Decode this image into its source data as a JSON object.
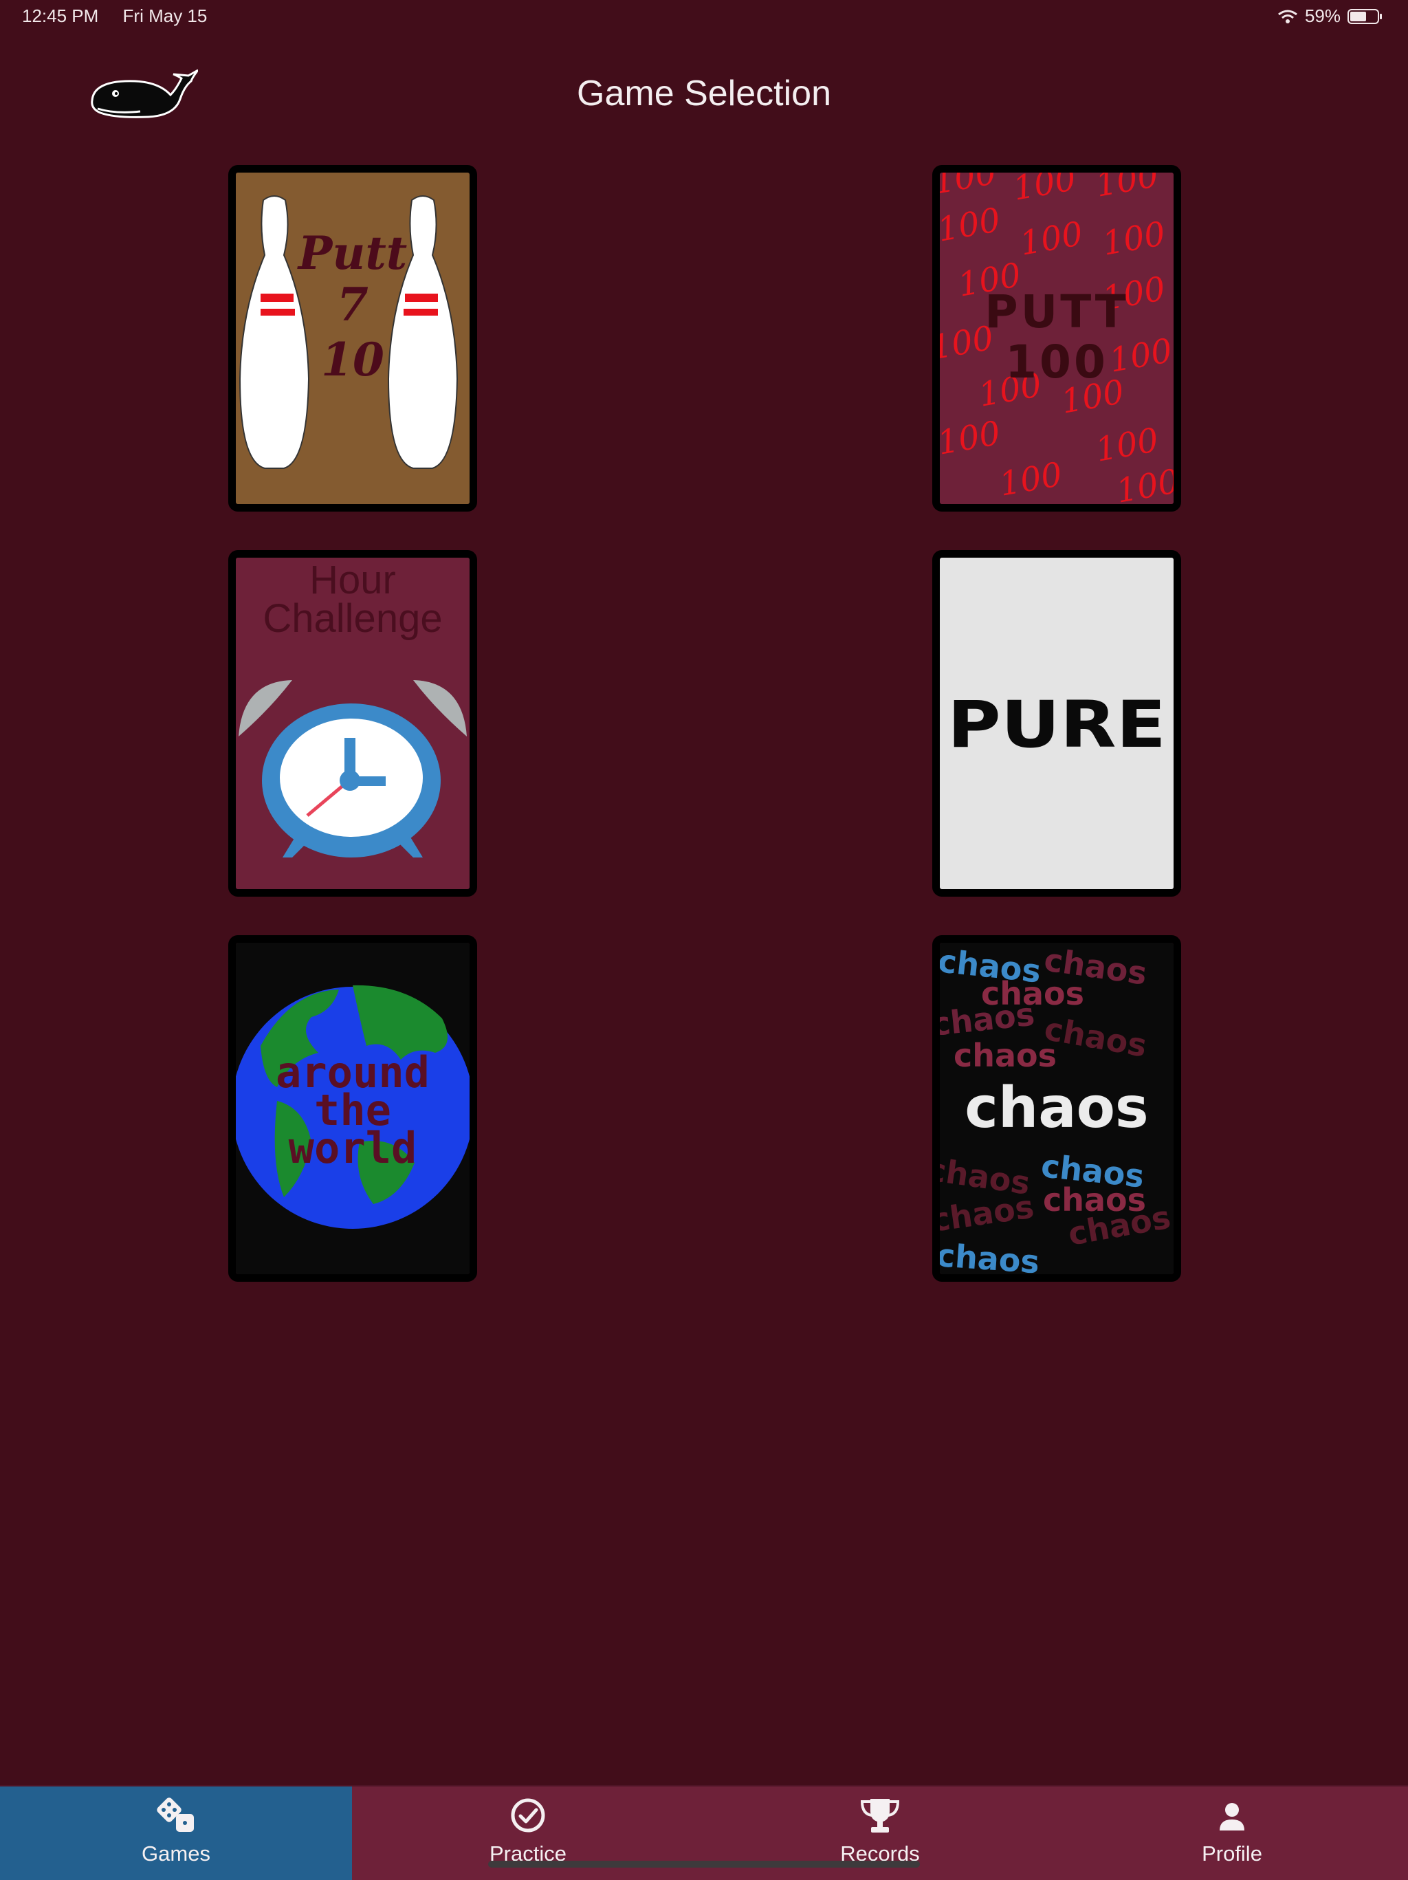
{
  "status": {
    "time": "12:45 PM",
    "date": "Fri May 15",
    "battery": "59%"
  },
  "header": {
    "title": "Game Selection",
    "logo_icon": "whale-icon"
  },
  "games": {
    "putt710": {
      "title": "Putt",
      "line2": "7",
      "line3": "10",
      "bg": "#845b30"
    },
    "putt100": {
      "title": "PUTT",
      "line2": "100",
      "pattern": "100",
      "bg": "#6e2139"
    },
    "hour": {
      "line1": "Hour",
      "line2": "Challenge",
      "bg": "#6e2139"
    },
    "pure": {
      "title": "PURE",
      "bg": "#e4e4e4"
    },
    "world": {
      "line1": "around",
      "line2": "the",
      "line3": "world",
      "bg": "#0a0a0a"
    },
    "chaos": {
      "title": "chaos",
      "pattern": "chaos",
      "bg": "#0a0a0a"
    }
  },
  "tabs": [
    {
      "label": "Games",
      "icon": "dice-icon",
      "active": true
    },
    {
      "label": "Practice",
      "icon": "checkmark-circle-icon",
      "active": false
    },
    {
      "label": "Records",
      "icon": "trophy-icon",
      "active": false
    },
    {
      "label": "Profile",
      "icon": "person-icon",
      "active": false
    }
  ],
  "colors": {
    "background": "#420d1a",
    "tabbar": "#6e2139",
    "tab_active": "#23608f",
    "card_border": "#000000"
  }
}
